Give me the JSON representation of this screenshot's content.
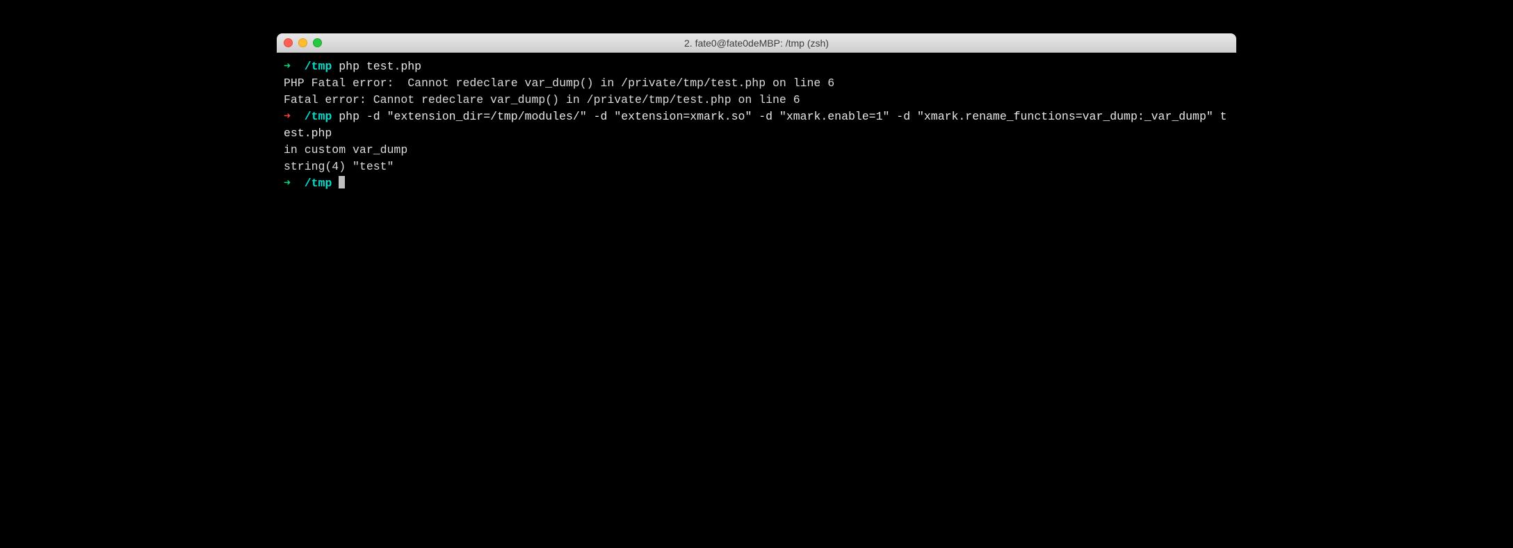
{
  "window": {
    "title": "2. fate0@fate0deMBP: /tmp (zsh)"
  },
  "colors": {
    "arrow_green": "#00d97e",
    "arrow_red": "#ff3b3b",
    "cwd": "#00e0d0",
    "text": "#dcdcdc",
    "bg": "#000000",
    "close": "#ff5f57",
    "minimize": "#ffbd2e",
    "maximize": "#28c940"
  },
  "lines": {
    "l0_arrow": "➜",
    "l0_cwd": "  /tmp",
    "l0_cmd": " php test.php",
    "l1": "PHP Fatal error:  Cannot redeclare var_dump() in /private/tmp/test.php on line 6",
    "l2": "",
    "l3": "Fatal error: Cannot redeclare var_dump() in /private/tmp/test.php on line 6",
    "l4_arrow": "➜",
    "l4_cwd": "  /tmp",
    "l4_cmd": " php -d \"extension_dir=/tmp/modules/\" -d \"extension=xmark.so\" -d \"xmark.enable=1\" -d \"xmark.rename_functions=var_dump:_var_dump\" test.php",
    "l5": "in custom var_dump",
    "l6": "string(4) \"test\"",
    "l7_arrow": "➜",
    "l7_cwd": "  /tmp "
  }
}
